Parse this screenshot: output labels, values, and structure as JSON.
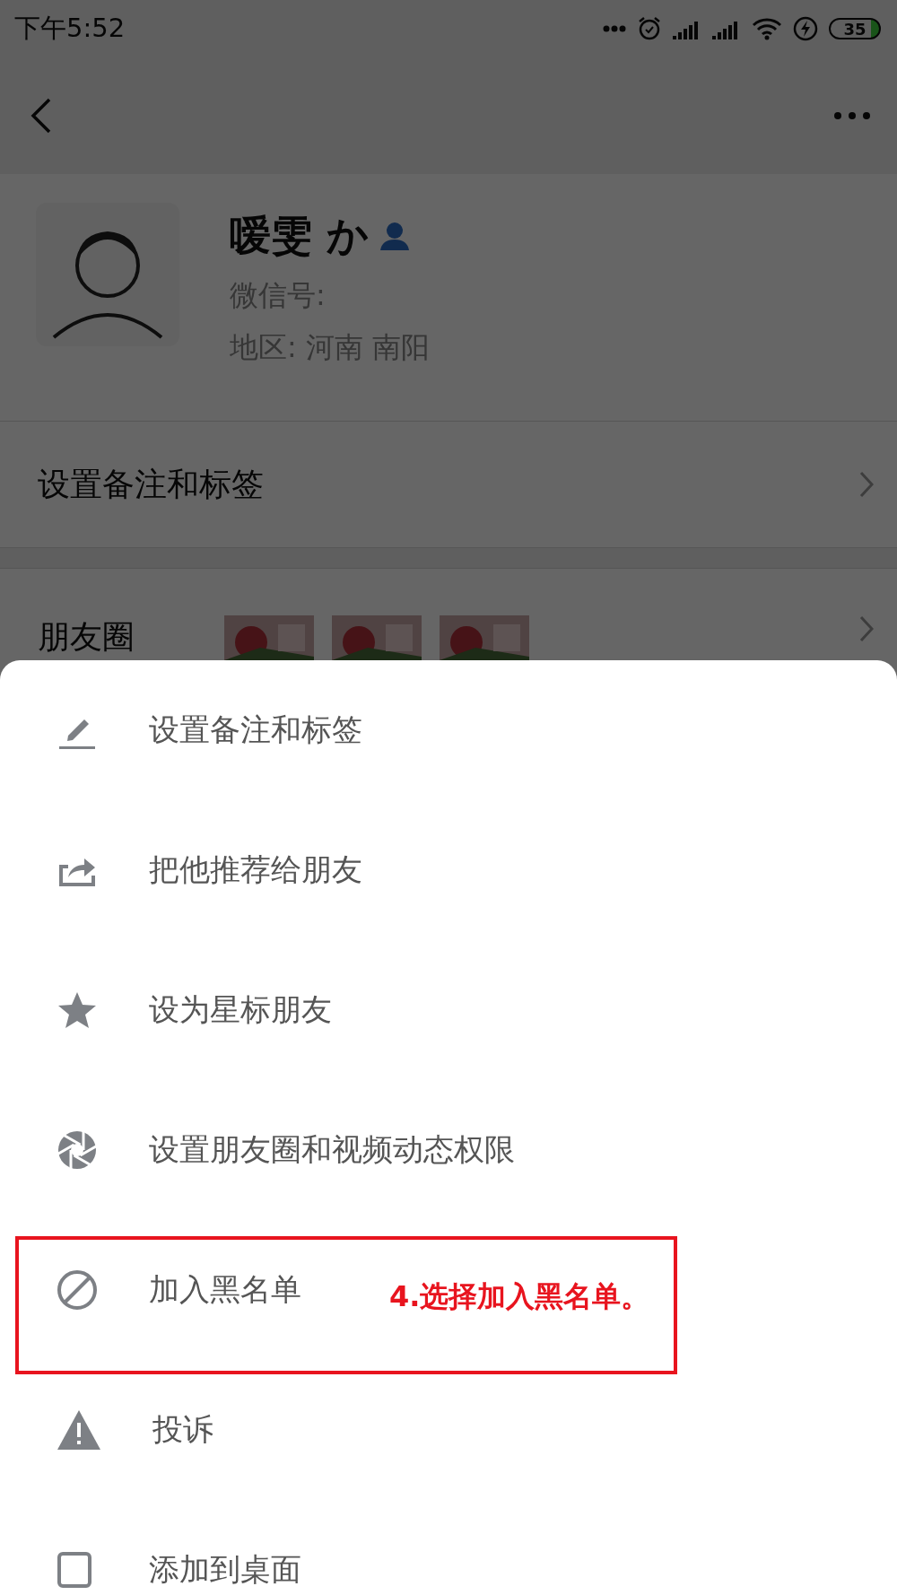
{
  "status_bar": {
    "time": "下午5:52",
    "battery": "35"
  },
  "profile": {
    "name": "嗳雯 か",
    "wechat_id_label": "微信号:",
    "region": "地区:  河南  南阳"
  },
  "rows": [
    {
      "label": "设置备注和标签"
    },
    {
      "label": "朋友圈"
    }
  ],
  "menu": [
    {
      "label": "设置备注和标签"
    },
    {
      "label": "把他推荐给朋友"
    },
    {
      "label": "设为星标朋友"
    },
    {
      "label": "设置朋友圈和视频动态权限"
    },
    {
      "label": "加入黑名单",
      "annotation": "4.选择加入黑名单。"
    },
    {
      "label": "投诉"
    },
    {
      "label": "添加到桌面"
    }
  ]
}
